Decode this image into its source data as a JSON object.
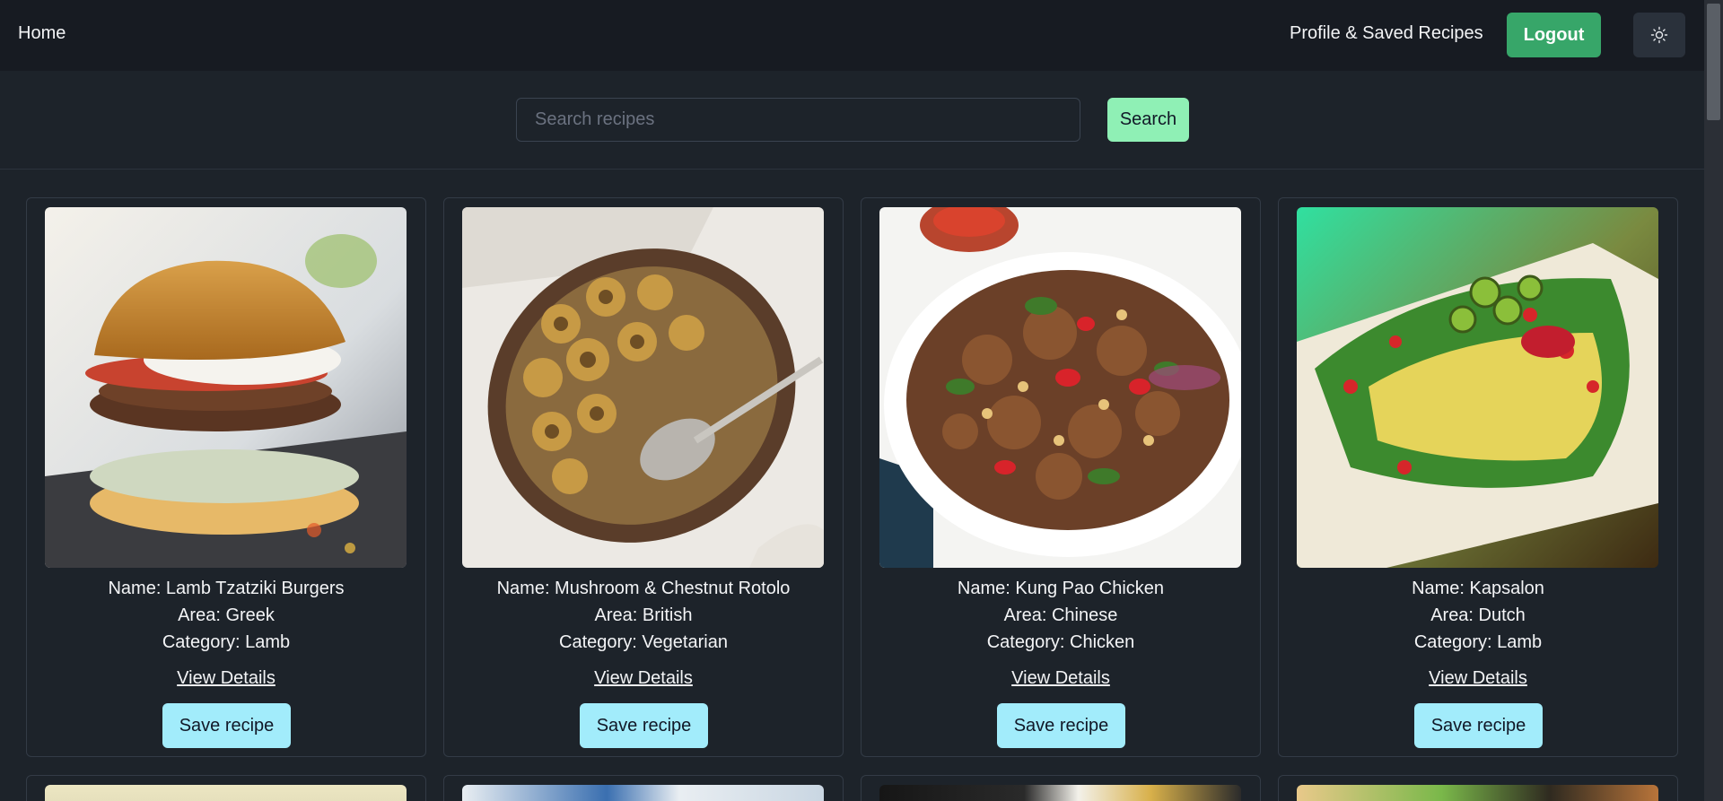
{
  "navbar": {
    "home_label": "Home",
    "profile_label": "Profile & Saved Recipes",
    "logout_label": "Logout",
    "theme_icon": "sun-icon"
  },
  "search": {
    "placeholder": "Search recipes",
    "value": "",
    "button_label": "Search"
  },
  "recipes": [
    {
      "name": "Name: Lamb Tzatziki Burgers",
      "area": "Area: Greek",
      "category": "Category: Lamb",
      "details_label": "View Details",
      "save_label": "Save recipe"
    },
    {
      "name": "Name: Mushroom & Chestnut Rotolo",
      "area": "Area: British",
      "category": "Category: Vegetarian",
      "details_label": "View Details",
      "save_label": "Save recipe"
    },
    {
      "name": "Name: Kung Pao Chicken",
      "area": "Area: Chinese",
      "category": "Category: Chicken",
      "details_label": "View Details",
      "save_label": "Save recipe"
    },
    {
      "name": "Name: Kapsalon",
      "area": "Area: Dutch",
      "category": "Category: Lamb",
      "details_label": "View Details",
      "save_label": "Save recipe"
    }
  ],
  "colors": {
    "background": "#1d232a",
    "navbar": "#171b22",
    "logout": "#37a669",
    "search_button": "#8ff0b5",
    "save_button": "#a2ecfb"
  }
}
